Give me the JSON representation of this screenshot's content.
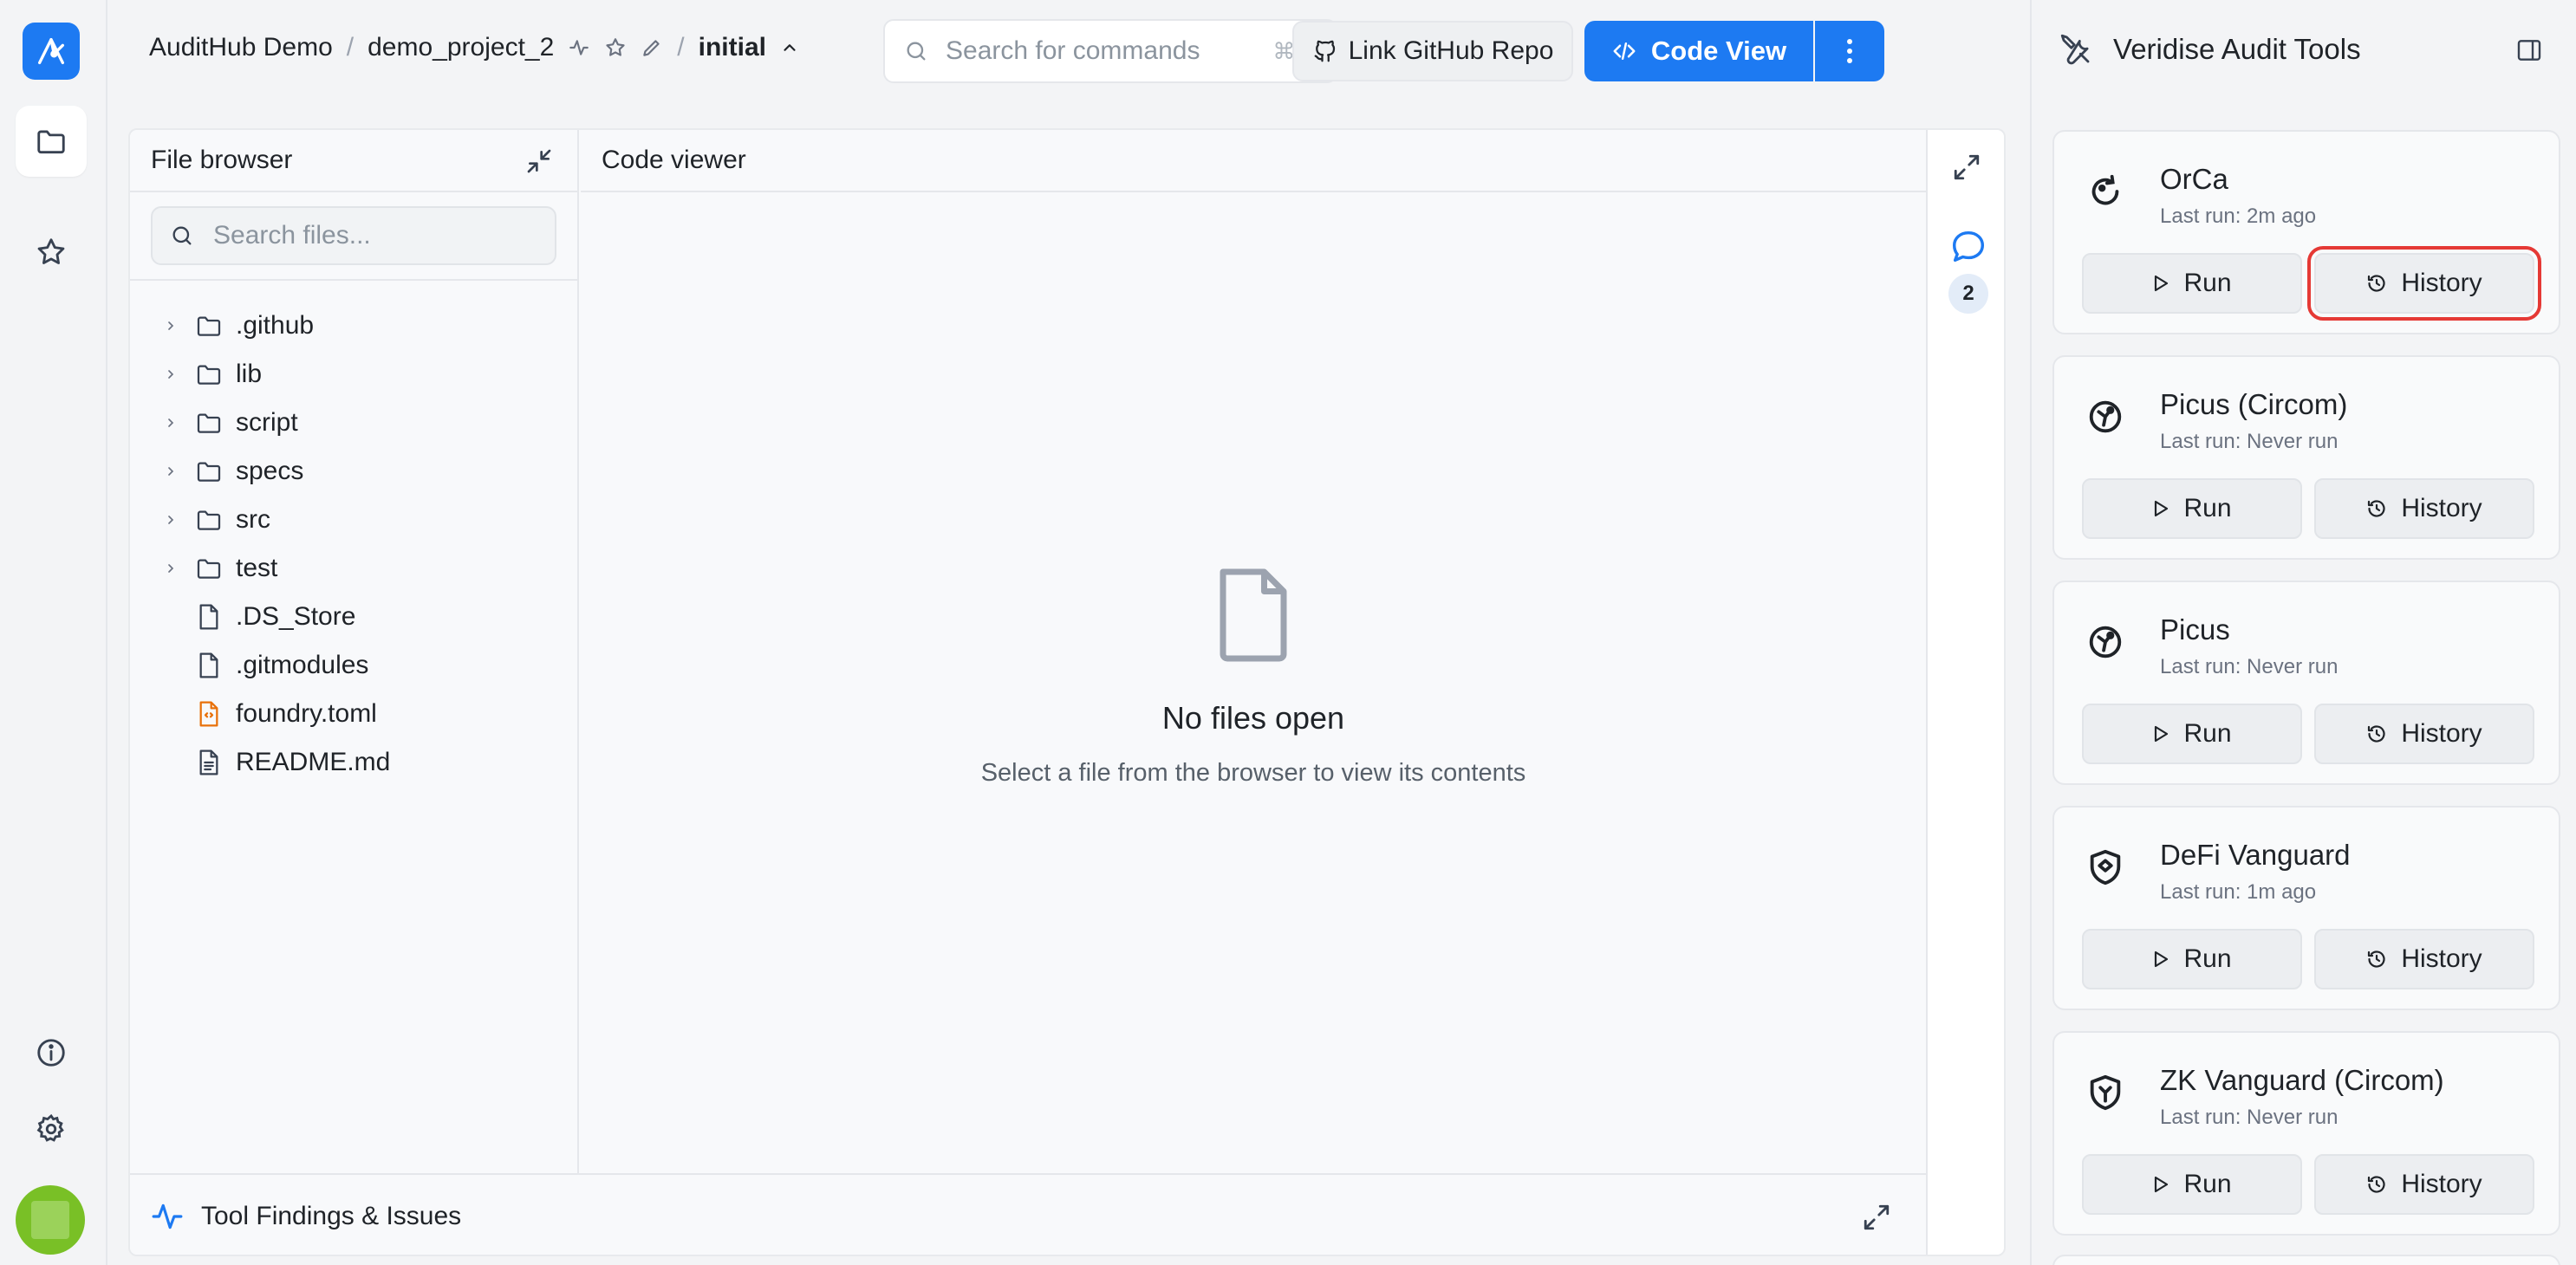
{
  "breadcrumb": {
    "org": "AuditHub Demo",
    "separator": "/",
    "project": "demo_project_2",
    "version": "initial"
  },
  "search": {
    "placeholder": "Search for commands",
    "shortcut": "⌘ K"
  },
  "toolbar": {
    "github_label": "Link GitHub Repo",
    "code_view_label": "Code View"
  },
  "file_browser": {
    "title": "File browser",
    "search_placeholder": "Search files...",
    "items": [
      {
        "name": ".github",
        "type": "folder"
      },
      {
        "name": "lib",
        "type": "folder"
      },
      {
        "name": "script",
        "type": "folder"
      },
      {
        "name": "specs",
        "type": "folder"
      },
      {
        "name": "src",
        "type": "folder"
      },
      {
        "name": "test",
        "type": "folder"
      },
      {
        "name": ".DS_Store",
        "type": "file"
      },
      {
        "name": ".gitmodules",
        "type": "file"
      },
      {
        "name": "foundry.toml",
        "type": "config"
      },
      {
        "name": "README.md",
        "type": "doc"
      }
    ]
  },
  "code_viewer": {
    "title": "Code viewer",
    "empty_title": "No files open",
    "empty_subtitle": "Select a file from the browser to view its contents"
  },
  "comments": {
    "count": "2"
  },
  "findings": {
    "label": "Tool Findings & Issues"
  },
  "tools_panel": {
    "title": "Veridise Audit Tools",
    "run_label": "Run",
    "history_label": "History",
    "tools": [
      {
        "name": "OrCa",
        "last_run": "Last run: 2m ago",
        "icon": "orca-icon"
      },
      {
        "name": "Picus (Circom)",
        "last_run": "Last run: Never run",
        "icon": "picus-icon"
      },
      {
        "name": "Picus",
        "last_run": "Last run: Never run",
        "icon": "picus-icon"
      },
      {
        "name": "DeFi Vanguard",
        "last_run": "Last run: 1m ago",
        "icon": "vanguard-icon"
      },
      {
        "name": "ZK Vanguard (Circom)",
        "last_run": "Last run: Never run",
        "icon": "zk-vanguard-icon"
      }
    ]
  },
  "colors": {
    "accent": "#1d7af2",
    "highlight": "#e53935",
    "avatar": "#79c026",
    "config_file": "#e8710a"
  }
}
